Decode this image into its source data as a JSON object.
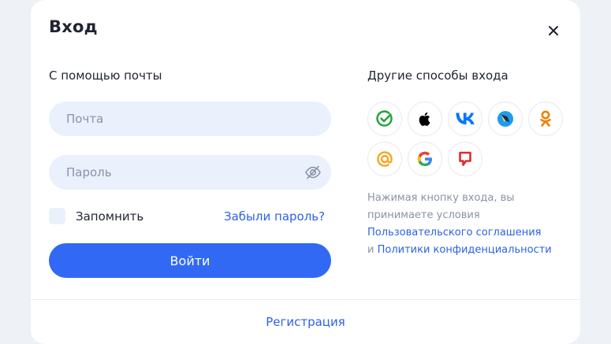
{
  "dialog": {
    "title": "Вход",
    "close_icon": "close-icon"
  },
  "email_login": {
    "heading": "С помощью почты",
    "email_placeholder": "Почта",
    "email_value": "",
    "password_placeholder": "Пароль",
    "password_value": "",
    "password_toggle_icon": "eye-off-icon",
    "remember_label": "Запомнить",
    "remember_checked": false,
    "forgot_label": "Забыли пароль?",
    "submit_label": "Войти"
  },
  "other_methods": {
    "heading": "Другие способы входа",
    "providers": [
      {
        "name": "sber-id",
        "icon": "sber-icon",
        "color": "#21a038"
      },
      {
        "name": "apple",
        "icon": "apple-icon",
        "color": "#000000"
      },
      {
        "name": "vk",
        "icon": "vk-icon",
        "color": "#0077ff"
      },
      {
        "name": "tinkoff-id",
        "icon": "tid-icon",
        "color": "#1e9cf0"
      },
      {
        "name": "odnoklassniki",
        "icon": "ok-icon",
        "color": "#ee8208"
      },
      {
        "name": "mail-ru",
        "icon": "mailru-icon",
        "color": "#f5a623"
      },
      {
        "name": "google",
        "icon": "google-icon",
        "color": "#4285f4"
      },
      {
        "name": "other-provider",
        "icon": "red-flag-icon",
        "color": "#e02c2c"
      }
    ],
    "terms_intro": "Нажимая кнопку входа, вы принимаете условия",
    "terms_link_1": "Пользовательского соглашения",
    "terms_and": "и",
    "terms_link_2": "Политики конфиденциальности"
  },
  "footer": {
    "register_label": "Регистрация"
  },
  "colors": {
    "accent": "#3169f5",
    "link": "#2c61e6",
    "input_bg": "#eaf1fd",
    "page_bg": "#eef1f6"
  }
}
